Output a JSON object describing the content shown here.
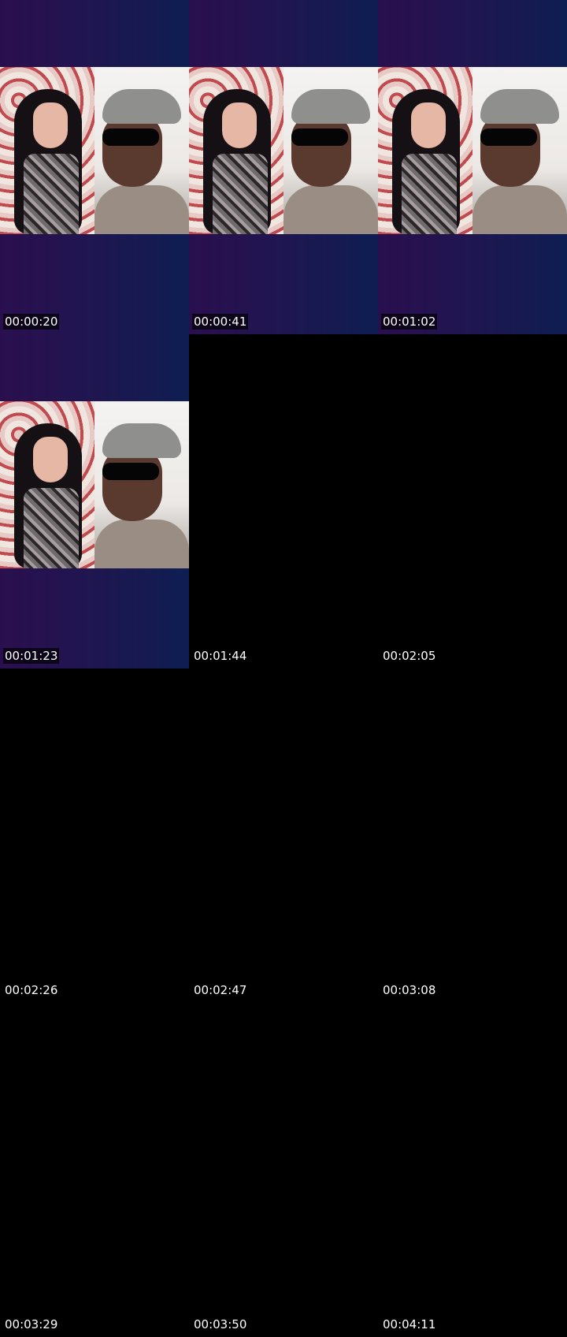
{
  "thumbnails": [
    {
      "timestamp": "00:00:20",
      "has_frame": true
    },
    {
      "timestamp": "00:00:41",
      "has_frame": true
    },
    {
      "timestamp": "00:01:02",
      "has_frame": true
    },
    {
      "timestamp": "00:01:23",
      "has_frame": true
    },
    {
      "timestamp": "00:01:44",
      "has_frame": false
    },
    {
      "timestamp": "00:02:05",
      "has_frame": false
    },
    {
      "timestamp": "00:02:26",
      "has_frame": false
    },
    {
      "timestamp": "00:02:47",
      "has_frame": false
    },
    {
      "timestamp": "00:03:08",
      "has_frame": false
    },
    {
      "timestamp": "00:03:29",
      "has_frame": false
    },
    {
      "timestamp": "00:03:50",
      "has_frame": false
    },
    {
      "timestamp": "00:04:11",
      "has_frame": false
    }
  ],
  "colors": {
    "background": "#000000",
    "frame_gradient_start": "#2a0f4e",
    "frame_gradient_end": "#0e1e52",
    "timestamp_text": "#ffffff"
  }
}
